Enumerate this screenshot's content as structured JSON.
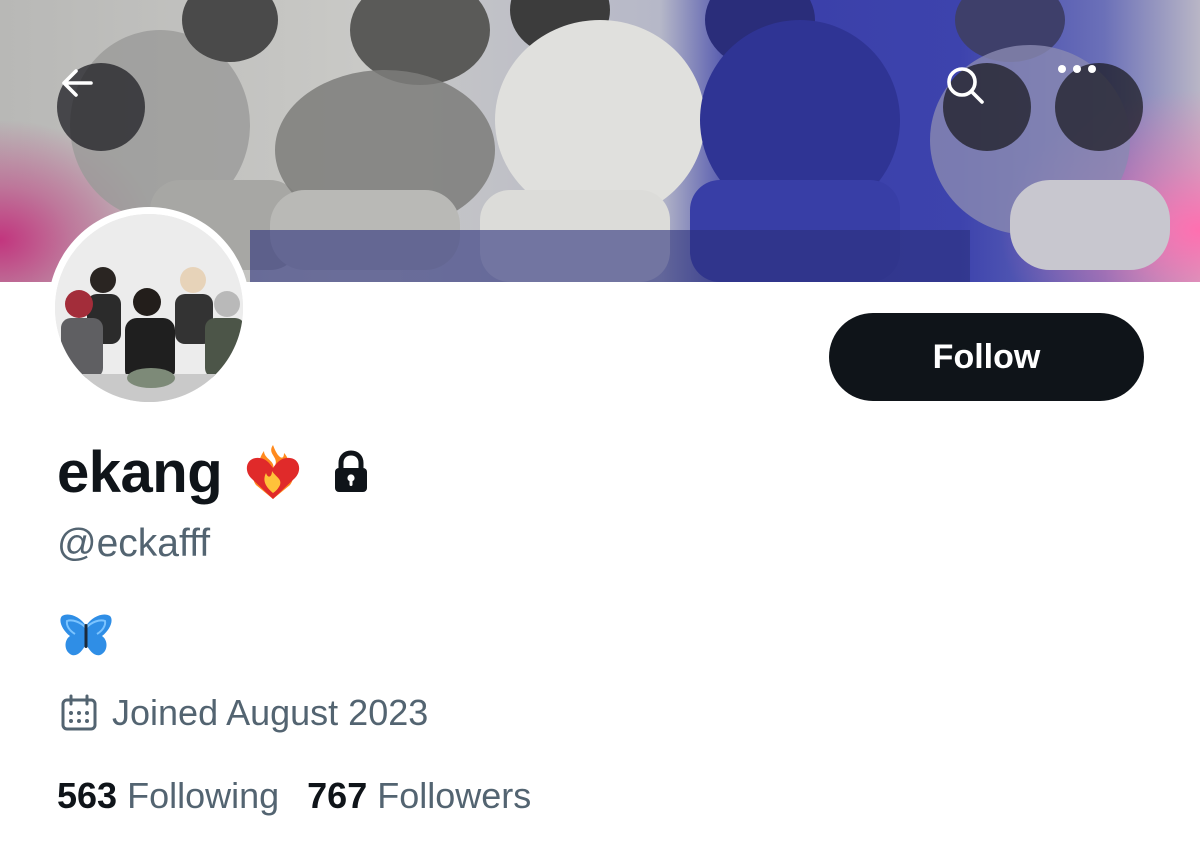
{
  "header": {
    "back_icon": "arrow-left-icon",
    "search_icon": "search-icon",
    "more_icon": "more-horizontal-icon"
  },
  "profile": {
    "display_name": "ekang",
    "name_emoji": "heart-on-fire-emoji",
    "protected_icon": "lock-icon",
    "handle": "@eckafff",
    "bio_emoji": "butterfly-emoji",
    "joined_icon": "calendar-icon",
    "joined": "Joined August 2023",
    "follow_label": "Follow",
    "following_count": "563",
    "following_label": "Following",
    "followers_count": "767",
    "followers_label": "Followers"
  },
  "colors": {
    "text_primary": "#0f1419",
    "text_secondary": "#536471",
    "follow_button_bg": "#0f1419",
    "banner_blue": "#3d43ad"
  }
}
